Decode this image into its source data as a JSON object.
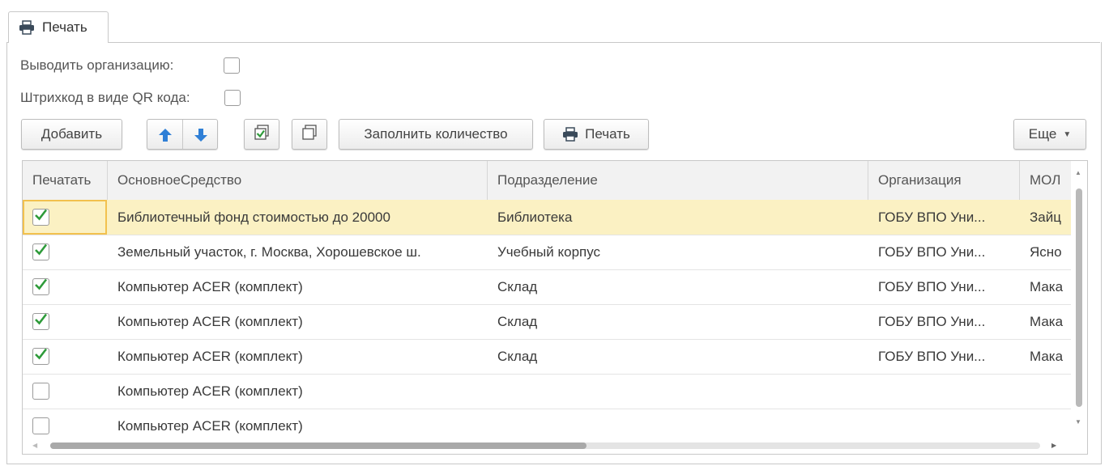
{
  "tab": {
    "label": "Печать",
    "icon": "printer-icon"
  },
  "options": {
    "show_org_label": "Выводить организацию:",
    "show_org_checked": false,
    "qr_label": "Штрихкод в виде QR кода:",
    "qr_checked": false
  },
  "toolbar": {
    "add_label": "Добавить",
    "fill_qty_label": "Заполнить количество",
    "print_label": "Печать",
    "more_label": "Еще"
  },
  "table": {
    "columns": [
      "Печатать",
      "ОсновноеСредство",
      "Подразделение",
      "Организация",
      "МОЛ"
    ],
    "rows": [
      {
        "print": true,
        "asset": "Библиотечный фонд стоимостью до 20000",
        "division": "Библиотека",
        "org": "ГОБУ ВПО Уни...",
        "mol": "Зайц",
        "selected": true
      },
      {
        "print": true,
        "asset": "Земельный участок, г. Москва, Хорошевское ш.",
        "division": "Учебный корпус",
        "org": "ГОБУ ВПО Уни...",
        "mol": "Ясно"
      },
      {
        "print": true,
        "asset": "Компьютер ACER (комплект)",
        "division": "Склад",
        "org": "ГОБУ ВПО Уни...",
        "mol": "Мака"
      },
      {
        "print": true,
        "asset": "Компьютер ACER (комплект)",
        "division": "Склад",
        "org": "ГОБУ ВПО Уни...",
        "mol": "Мака"
      },
      {
        "print": true,
        "asset": "Компьютер ACER (комплект)",
        "division": "Склад",
        "org": "ГОБУ ВПО Уни...",
        "mol": "Мака"
      },
      {
        "print": false,
        "asset": "Компьютер ACER (комплект)",
        "division": "",
        "org": "",
        "mol": ""
      },
      {
        "print": false,
        "asset": "Компьютер ACER (комплект)",
        "division": "",
        "org": "",
        "mol": ""
      }
    ]
  },
  "colors": {
    "selected_row": "#fbf1c3",
    "check_green": "#2e9b3a",
    "arrow_blue": "#2f7fd6"
  }
}
